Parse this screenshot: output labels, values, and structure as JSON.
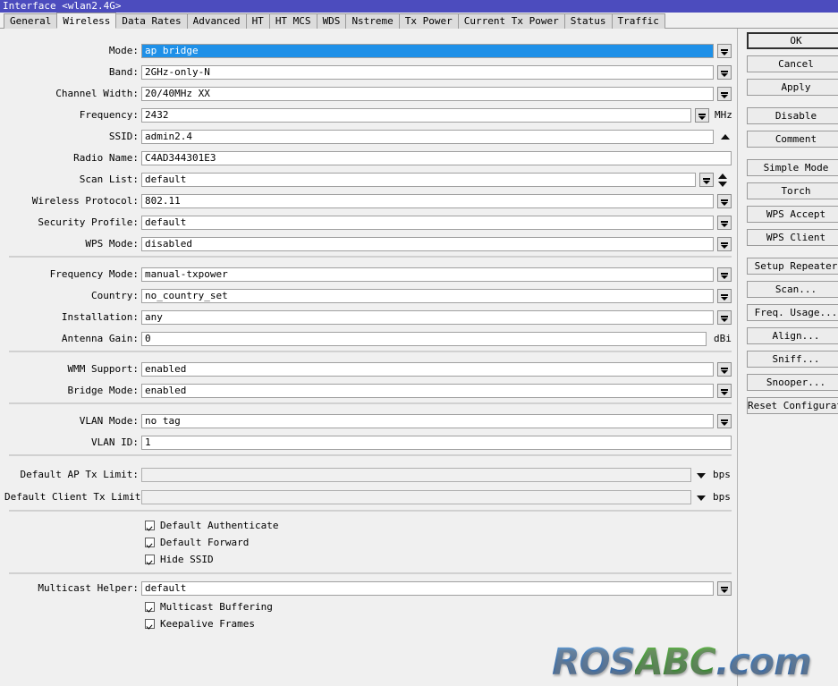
{
  "window": {
    "title": "Interface <wlan2.4G>"
  },
  "tabs": [
    {
      "label": "General",
      "active": false
    },
    {
      "label": "Wireless",
      "active": true
    },
    {
      "label": "Data Rates",
      "active": false
    },
    {
      "label": "Advanced",
      "active": false
    },
    {
      "label": "HT",
      "active": false
    },
    {
      "label": "HT MCS",
      "active": false
    },
    {
      "label": "WDS",
      "active": false
    },
    {
      "label": "Nstreme",
      "active": false
    },
    {
      "label": "Tx Power",
      "active": false
    },
    {
      "label": "Current Tx Power",
      "active": false
    },
    {
      "label": "Status",
      "active": false
    },
    {
      "label": "Traffic",
      "active": false
    }
  ],
  "fields": {
    "mode": {
      "label": "Mode:",
      "value": "ap bridge"
    },
    "band": {
      "label": "Band:",
      "value": "2GHz-only-N"
    },
    "channel_width": {
      "label": "Channel Width:",
      "value": "20/40MHz XX"
    },
    "frequency": {
      "label": "Frequency:",
      "value": "2432",
      "unit": "MHz"
    },
    "ssid": {
      "label": "SSID:",
      "value": "admin2.4"
    },
    "radio_name": {
      "label": "Radio Name:",
      "value": "C4AD344301E3"
    },
    "scan_list": {
      "label": "Scan List:",
      "value": "default"
    },
    "wireless_protocol": {
      "label": "Wireless Protocol:",
      "value": "802.11"
    },
    "security_profile": {
      "label": "Security Profile:",
      "value": "default"
    },
    "wps_mode": {
      "label": "WPS Mode:",
      "value": "disabled"
    },
    "frequency_mode": {
      "label": "Frequency Mode:",
      "value": "manual-txpower"
    },
    "country": {
      "label": "Country:",
      "value": "no_country_set"
    },
    "installation": {
      "label": "Installation:",
      "value": "any"
    },
    "antenna_gain": {
      "label": "Antenna Gain:",
      "value": "0",
      "unit": "dBi"
    },
    "wmm_support": {
      "label": "WMM Support:",
      "value": "enabled"
    },
    "bridge_mode": {
      "label": "Bridge Mode:",
      "value": "enabled"
    },
    "vlan_mode": {
      "label": "VLAN Mode:",
      "value": "no tag"
    },
    "vlan_id": {
      "label": "VLAN ID:",
      "value": "1"
    },
    "default_ap_tx": {
      "label": "Default AP Tx Limit:",
      "value": "",
      "unit": "bps"
    },
    "default_client_tx": {
      "label": "Default Client Tx Limit:",
      "value": "",
      "unit": "bps"
    },
    "multicast_helper": {
      "label": "Multicast Helper:",
      "value": "default"
    }
  },
  "checkboxes": {
    "default_authenticate": {
      "label": "Default Authenticate",
      "checked": true
    },
    "default_forward": {
      "label": "Default Forward",
      "checked": true
    },
    "hide_ssid": {
      "label": "Hide SSID",
      "checked": true
    },
    "multicast_buffering": {
      "label": "Multicast Buffering",
      "checked": true
    },
    "keepalive_frames": {
      "label": "Keepalive Frames",
      "checked": true
    }
  },
  "buttons": [
    {
      "label": "OK",
      "default": true
    },
    {
      "label": "Cancel",
      "default": false
    },
    {
      "label": "Apply",
      "default": false
    },
    {
      "label": "Disable",
      "default": false
    },
    {
      "label": "Comment",
      "default": false
    },
    {
      "label": "Simple Mode",
      "default": false
    },
    {
      "label": "Torch",
      "default": false
    },
    {
      "label": "WPS Accept",
      "default": false
    },
    {
      "label": "WPS Client",
      "default": false
    },
    {
      "label": "Setup Repeater",
      "default": false
    },
    {
      "label": "Scan...",
      "default": false
    },
    {
      "label": "Freq. Usage...",
      "default": false
    },
    {
      "label": "Align...",
      "default": false
    },
    {
      "label": "Sniff...",
      "default": false
    },
    {
      "label": "Snooper...",
      "default": false
    },
    {
      "label": "Reset Configuration",
      "default": false
    }
  ],
  "watermark": {
    "part1": "ROS",
    "part2": "ABC",
    "part3": ".com",
    "color_blue": "#3d77b8",
    "color_green": "#3f9a34"
  },
  "colors": {
    "titlebar": "#4c4cbe",
    "selection": "#1e90e8",
    "window_bg": "#f0f0f0",
    "tab_inactive": "#dcdcdc"
  }
}
